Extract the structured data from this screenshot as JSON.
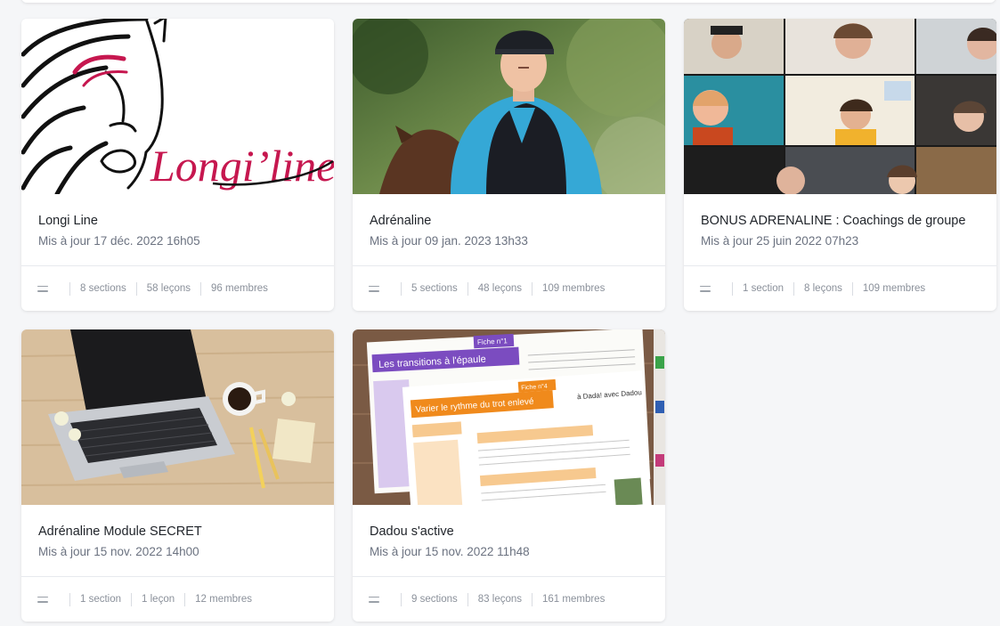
{
  "courses": [
    {
      "title": "Longi Line",
      "updated": "Mis à jour 17 déc. 2022 16h05",
      "sections": "8 sections",
      "lessons": "58 leçons",
      "members": "96 membres",
      "thumbnail_text": "Longi’line",
      "thumbnail_colors": {
        "accent": "#c6174f",
        "ink": "#111111"
      }
    },
    {
      "title": "Adrénaline",
      "updated": "Mis à jour 09 jan. 2023 13h33",
      "sections": "5 sections",
      "lessons": "48 leçons",
      "members": "109 membres"
    },
    {
      "title": "BONUS ADRENALINE : Coachings de groupe",
      "updated": "Mis à jour 25 juin 2022 07h23",
      "sections": "1 section",
      "lessons": "8 leçons",
      "members": "109 membres"
    },
    {
      "title": "Adrénaline Module SECRET",
      "updated": "Mis à jour 15 nov. 2022 14h00",
      "sections": "1 section",
      "lessons": "1 leçon",
      "members": "12 membres"
    },
    {
      "title": "Dadou s'active",
      "updated": "Mis à jour 15 nov. 2022 11h48",
      "sections": "9 sections",
      "lessons": "83 leçons",
      "members": "161 membres",
      "thumbnail_sheets": [
        {
          "label": "Fiche n°1",
          "heading": "Les transitions à l'épaule",
          "color": "#7b4cc0"
        },
        {
          "label": "Fiche n°4",
          "heading": "Varier le rythme du trot enlevé",
          "color": "#f08a1c"
        }
      ],
      "thumbnail_logo": "à Dada! avec Dadou"
    }
  ],
  "icons": {
    "stats_menu": "menu-lines-icon"
  }
}
